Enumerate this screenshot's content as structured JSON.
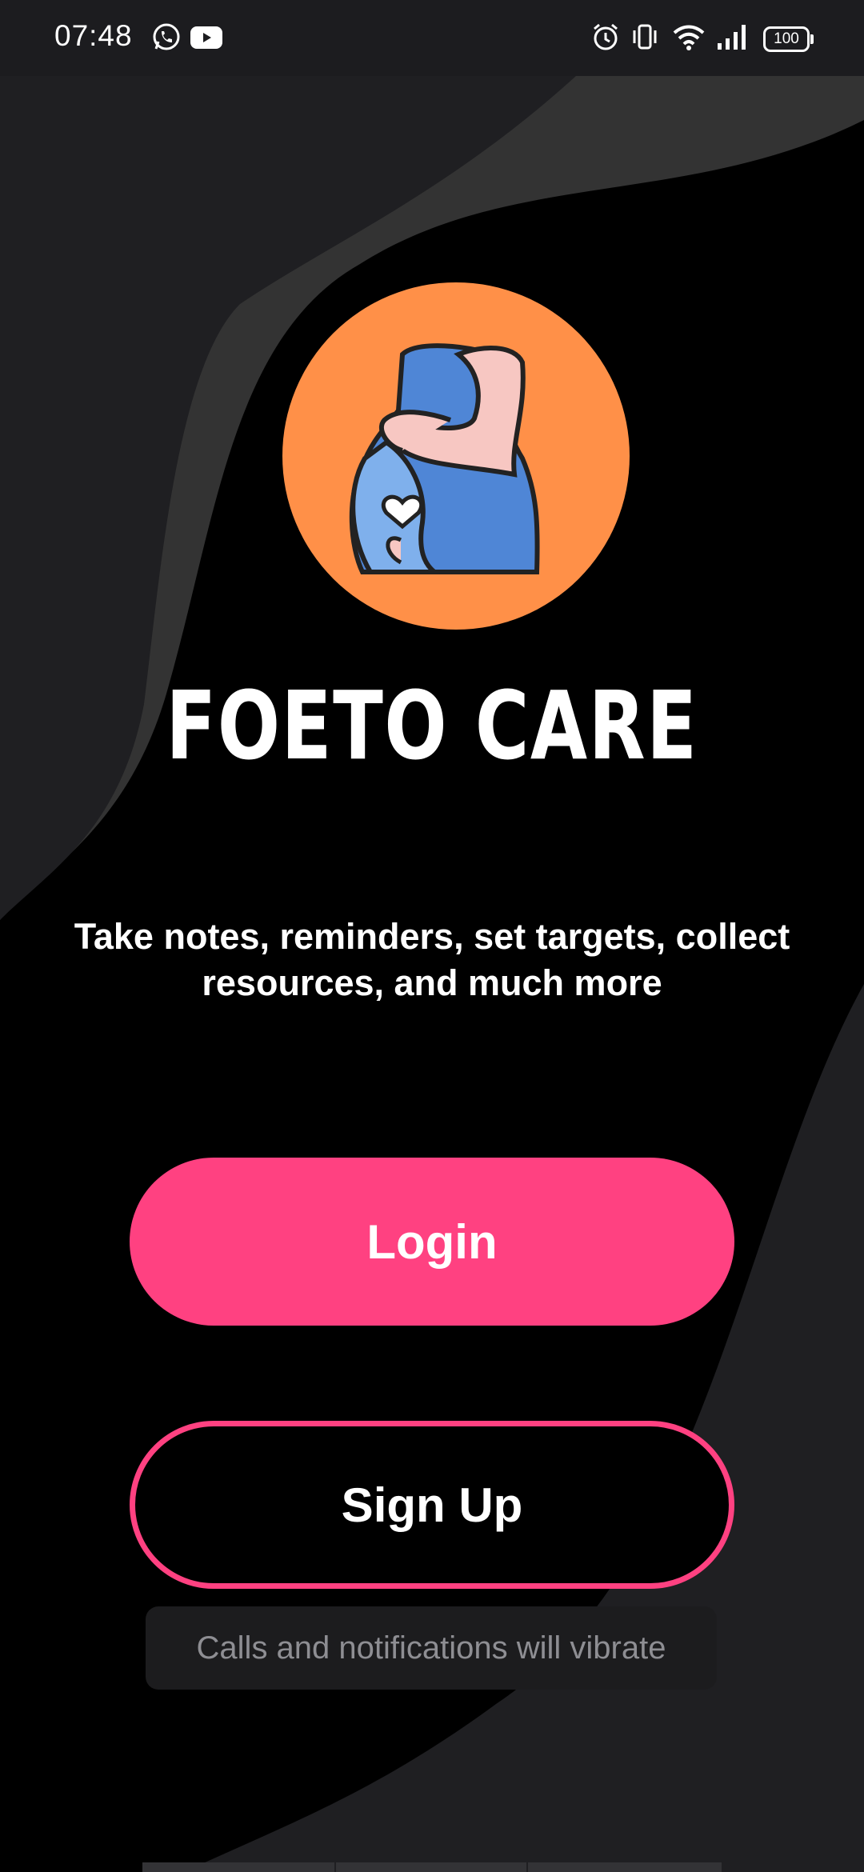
{
  "status_bar": {
    "time": "07:48",
    "left_icons": [
      "whatsapp-icon",
      "youtube-icon"
    ],
    "right_icons": [
      "alarm-icon",
      "vibrate-icon",
      "wifi-icon",
      "signal-icon"
    ],
    "battery": "100"
  },
  "app": {
    "title": "FOETO CARE",
    "tagline": "Take notes, reminders, set targets, collect resources, and much more",
    "logo_icon": "pregnant-woman-icon"
  },
  "buttons": {
    "login_label": "Login",
    "signup_label": "Sign Up"
  },
  "toast": {
    "message": "Calls and notifications will vibrate"
  },
  "colors": {
    "accent": "#ff4181",
    "logo_background": "#ff9048",
    "background": "#000000",
    "wave": "#1f1f22"
  }
}
